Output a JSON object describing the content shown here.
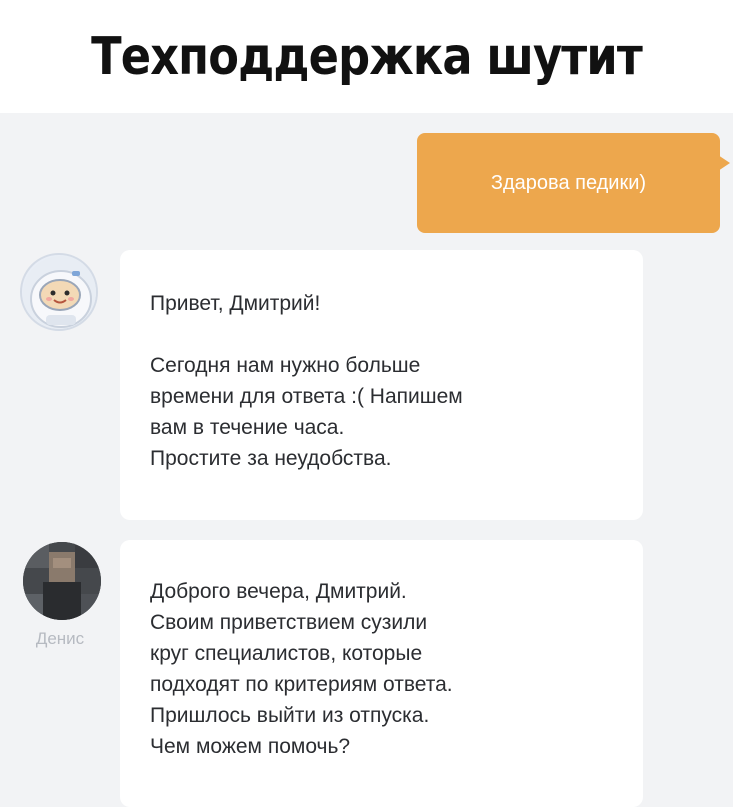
{
  "title": "Техподдержка шутит",
  "chat": {
    "outgoing": {
      "text": "Здарова педики)",
      "color": "#eda74d"
    },
    "messages": [
      {
        "avatar_icon": "astronaut-avatar-icon",
        "sender": "",
        "paragraphs": [
          [
            "Привет, Дмитрий!"
          ],
          [
            "Сегодня нам нужно больше",
            "времени для ответа :( Напишем",
            "вам в течение часа.",
            "Простите за неудобства."
          ]
        ]
      },
      {
        "avatar_icon": "blurred-person-avatar-icon",
        "sender": "Денис",
        "paragraphs": [
          [
            "Доброго вечера, Дмитрий.",
            "Своим приветствием сузили",
            "круг специалистов, которые",
            "подходят по критериям ответа.",
            "Пришлось выйти из отпуска.",
            "Чем можем помочь?"
          ]
        ]
      }
    ]
  }
}
